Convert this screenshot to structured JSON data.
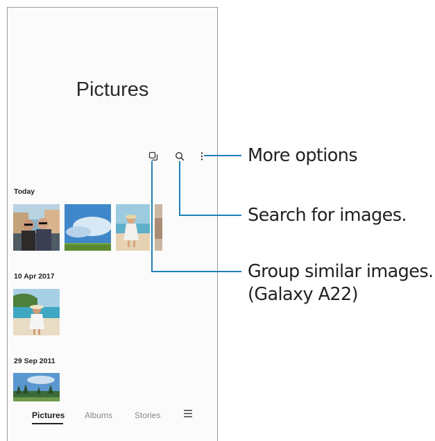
{
  "screen": {
    "title": "Pictures",
    "toolbar": {
      "group_icon": "group-similar-icon",
      "search_icon": "search-icon",
      "more_icon": "more-options-icon"
    },
    "sections": [
      {
        "date": "Today"
      },
      {
        "date": "10 Apr 2017"
      },
      {
        "date": "29 Sep 2011"
      }
    ],
    "bottom_nav": [
      {
        "label": "Pictures",
        "active": true
      },
      {
        "label": "Albums",
        "active": false
      },
      {
        "label": "Stories",
        "active": false
      }
    ],
    "menu_icon": "hamburger-menu-icon"
  },
  "callouts": {
    "more_options": "More options",
    "search": "Search for images.",
    "group_line1": "Group similar images.",
    "group_line2": "(Galaxy A22)"
  },
  "colors": {
    "callout_line": "#1f7fb5",
    "text": "#222222"
  }
}
